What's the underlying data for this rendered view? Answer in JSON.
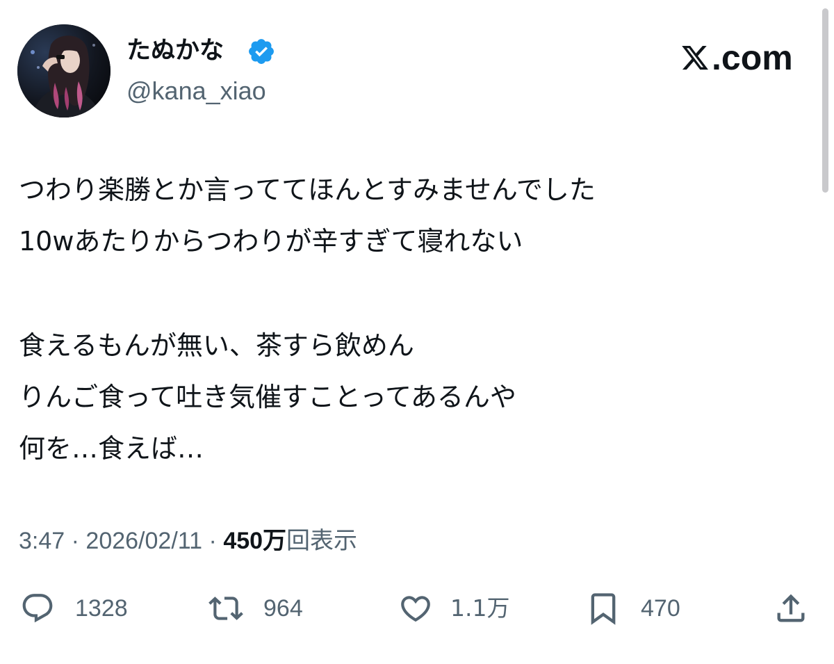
{
  "author": {
    "display_name": "たぬかな",
    "handle": "@kana_xiao",
    "verified": true
  },
  "brand": {
    "domain": ".com",
    "logo_icon": "x-logo-icon"
  },
  "tweet": {
    "lines": [
      "つわり楽勝とか言っててほんとすみませんでした",
      "10wあたりからつわりが辛すぎて寝れない",
      "食えるもんが無い、茶すら飲めん",
      "りんご食って吐き気催すことってあるんや",
      "何を…食えば…"
    ]
  },
  "meta": {
    "time": "3:47",
    "separator": "·",
    "date": "2026/02/11",
    "views_count": "450万",
    "views_label": "回表示"
  },
  "actions": {
    "replies": "1328",
    "reposts": "964",
    "likes": "1.1万",
    "bookmarks": "470"
  },
  "colors": {
    "text": "#0f1419",
    "secondary": "#536471",
    "verified_badge": "#1d9bf0",
    "background": "#ffffff"
  }
}
